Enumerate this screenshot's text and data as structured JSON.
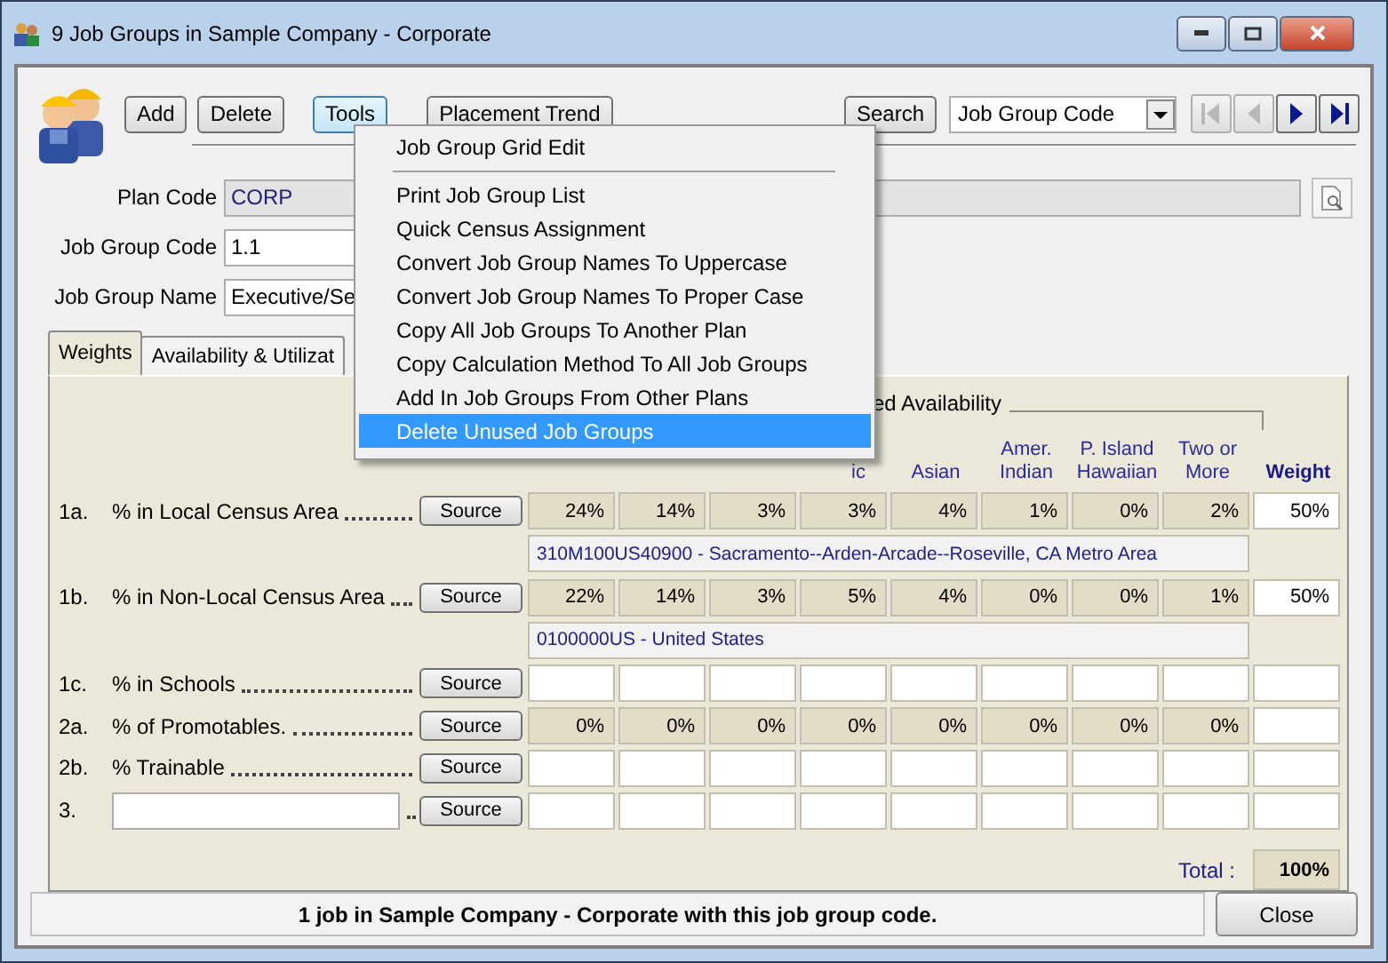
{
  "window": {
    "title": "9 Job Groups in Sample Company - Corporate"
  },
  "toolbar": {
    "buttons": [
      "Add",
      "Delete",
      "Tools",
      "Placement Trend"
    ],
    "search_button": "Search",
    "sort_select": "Job Group Code",
    "nav": [
      {
        "kind": "first",
        "disabled": true
      },
      {
        "kind": "prev",
        "disabled": true
      },
      {
        "kind": "next",
        "disabled": false
      },
      {
        "kind": "last",
        "disabled": false
      }
    ]
  },
  "form": [
    {
      "label": "Plan Code",
      "value": "CORP",
      "kind": "plan"
    },
    {
      "label": "Job Group Code",
      "value": "1.1",
      "kind": "code"
    },
    {
      "label": "Job Group Name",
      "value": "Executive/Se",
      "kind": "name"
    }
  ],
  "tabs": [
    {
      "label": "Weights",
      "selected": true
    },
    {
      "label": "Availability & Utilizat",
      "selected": false
    }
  ],
  "group_label": "ed Availability",
  "columns": [
    "ic",
    "Asian",
    "Amer. Indian",
    "P. Island Hawaiian",
    "Two or More"
  ],
  "weight_header": "Weight",
  "rows": [
    {
      "number": "1a.",
      "label": "% in Local Census Area",
      "source": "Source",
      "values": [
        "24%",
        "14%",
        "3%",
        "3%",
        "4%",
        "1%",
        "0%",
        "2%"
      ],
      "weight": "50%",
      "area": "310M100US40900 - Sacramento--Arden-Arcade--Roseville, CA Metro Area"
    },
    {
      "number": "1b.",
      "label": "% in Non-Local Census Area",
      "source": "Source",
      "values": [
        "22%",
        "14%",
        "3%",
        "5%",
        "4%",
        "0%",
        "0%",
        "1%"
      ],
      "weight": "50%",
      "area": "0100000US - United States"
    },
    {
      "number": "1c.",
      "label": "% in Schools",
      "source": "Source"
    },
    {
      "number": "2a.",
      "label": "% of Promotables.",
      "source": "Source",
      "values": [
        "0%",
        "0%",
        "0%",
        "0%",
        "0%",
        "0%",
        "0%",
        "0%"
      ]
    },
    {
      "number": "2b.",
      "label": "% Trainable",
      "source": "Source"
    },
    {
      "number": "3.",
      "kind": "custom",
      "source": "Source"
    }
  ],
  "total": {
    "label": "Total :",
    "value": "100%"
  },
  "status": "1 job in Sample Company - Corporate with this job group code.",
  "close": "Close",
  "menu": {
    "items": [
      {
        "kind": "item",
        "label": "Job Group Grid Edit",
        "selected": false
      },
      {
        "kind": "separator"
      },
      {
        "kind": "item",
        "label": "Print Job Group List",
        "selected": false
      },
      {
        "kind": "item",
        "label": "Quick Census Assignment",
        "selected": false
      },
      {
        "kind": "item",
        "label": "Convert Job Group Names To Uppercase",
        "selected": false
      },
      {
        "kind": "item",
        "label": "Convert Job Group Names To Proper Case",
        "selected": false
      },
      {
        "kind": "item",
        "label": "Copy All Job Groups To Another Plan",
        "selected": false
      },
      {
        "kind": "item",
        "label": "Copy Calculation Method To All Job Groups",
        "selected": false
      },
      {
        "kind": "item",
        "label": "Add In Job Groups From Other Plans",
        "selected": false
      },
      {
        "kind": "item",
        "label": "Delete Unused Job Groups",
        "selected": true
      }
    ]
  }
}
